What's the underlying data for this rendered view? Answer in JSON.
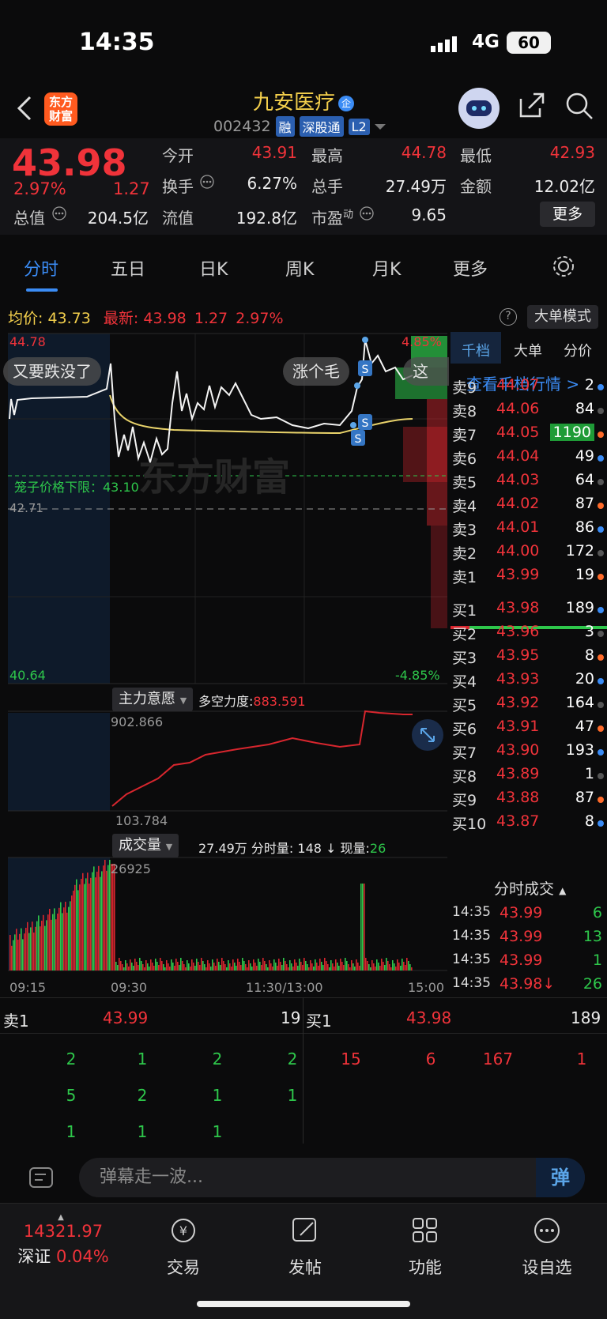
{
  "status_bar": {
    "time": "14:35",
    "network": "4G",
    "battery": "60"
  },
  "header": {
    "back_icon": "chevron-left-icon",
    "logo_text_1": "东方",
    "logo_text_2": "财富",
    "stock_name": "九安医疗",
    "badge": "企",
    "code": "002432",
    "tags": [
      "融",
      "深股通",
      "L2"
    ]
  },
  "quote": {
    "price": "43.98",
    "pct": "2.97%",
    "change": "1.27",
    "fields": [
      {
        "label": "今开",
        "value": "43.91",
        "color": "red"
      },
      {
        "label": "最高",
        "value": "44.78",
        "color": "red"
      },
      {
        "label": "最低",
        "value": "42.93",
        "color": "red"
      },
      {
        "label": "换手",
        "value": "6.27%",
        "color": "white"
      },
      {
        "label": "总手",
        "value": "27.49万",
        "color": "white"
      },
      {
        "label": "金额",
        "value": "12.02亿",
        "color": "white"
      },
      {
        "label": "总值",
        "value": "204.5亿",
        "color": "white"
      },
      {
        "label": "流值",
        "value": "192.8亿",
        "color": "white"
      },
      {
        "label": "市盈",
        "value": "9.65",
        "color": "white",
        "sup": "动"
      }
    ],
    "more_label": "更多"
  },
  "tabs": [
    "分时",
    "五日",
    "日K",
    "周K",
    "月K",
    "更多"
  ],
  "avg_row": {
    "avg_label": "均价:",
    "avg_value": "43.73",
    "latest_label": "最新:",
    "latest_value": "43.98",
    "latest_change": "1.27",
    "latest_pct": "2.97%",
    "bigorder_label": "大单模式"
  },
  "chart": {
    "top_price": "44.78",
    "bottom_price": "40.64",
    "top_pct": "4.85%",
    "bottom_pct": "-4.85%",
    "prev_close": "42.71",
    "cage_label": "笼子价格下限：43.10",
    "bubbles": [
      "又要跌没了",
      "涨个毛",
      "这多"
    ],
    "watermark": "东方财富",
    "ind1_name": "主力意愿",
    "ind1_label": "多空力度:",
    "ind1_value": "883.591",
    "ind1_max": "902.866",
    "ind1_min": "103.784",
    "ind2_name": "成交量",
    "ind2_total": "27.49万",
    "ind2_min_label": "分时量: 148 ↓",
    "ind2_now_label": "现量:",
    "ind2_now_value": "26",
    "ind2_max": "26925",
    "time_labels": [
      "09:15",
      "09:30",
      "11:30/13:00",
      "15:00"
    ]
  },
  "book": {
    "tabs": [
      "千档",
      "大单",
      "分价"
    ],
    "link": "查看千档行情 >",
    "asks": [
      {
        "label": "卖9",
        "price": "44.07",
        "vol": "2"
      },
      {
        "label": "卖8",
        "price": "44.06",
        "vol": "84"
      },
      {
        "label": "卖7",
        "price": "44.05",
        "vol": "1190"
      },
      {
        "label": "卖6",
        "price": "44.04",
        "vol": "49"
      },
      {
        "label": "卖5",
        "price": "44.03",
        "vol": "64"
      },
      {
        "label": "卖4",
        "price": "44.02",
        "vol": "87"
      },
      {
        "label": "卖3",
        "price": "44.01",
        "vol": "86"
      },
      {
        "label": "卖2",
        "price": "44.00",
        "vol": "172"
      },
      {
        "label": "卖1",
        "price": "43.99",
        "vol": "19"
      }
    ],
    "bids": [
      {
        "label": "买1",
        "price": "43.98",
        "vol": "189"
      },
      {
        "label": "买2",
        "price": "43.96",
        "vol": "3"
      },
      {
        "label": "买3",
        "price": "43.95",
        "vol": "8"
      },
      {
        "label": "买4",
        "price": "43.93",
        "vol": "20"
      },
      {
        "label": "买5",
        "price": "43.92",
        "vol": "164"
      },
      {
        "label": "买6",
        "price": "43.91",
        "vol": "47"
      },
      {
        "label": "买7",
        "price": "43.90",
        "vol": "193"
      },
      {
        "label": "买8",
        "price": "43.89",
        "vol": "1"
      },
      {
        "label": "买9",
        "price": "43.88",
        "vol": "87"
      },
      {
        "label": "买10",
        "price": "43.87",
        "vol": "8"
      }
    ],
    "ticks_title": "分时成交",
    "ticks": [
      {
        "time": "14:35",
        "price": "43.99",
        "vol": "6"
      },
      {
        "time": "14:35",
        "price": "43.99",
        "vol": "13"
      },
      {
        "time": "14:35",
        "price": "43.99",
        "vol": "1"
      },
      {
        "time": "14:35",
        "price": "43.98↓",
        "vol": "26"
      }
    ]
  },
  "l2": {
    "sell_label": "卖1",
    "sell_price": "43.99",
    "sell_vol": "19",
    "buy_label": "买1",
    "buy_price": "43.98",
    "buy_vol": "189",
    "sell_queue": [
      "2",
      "1",
      "2",
      "2",
      "5",
      "2",
      "1",
      "1",
      "1",
      "1",
      "1"
    ],
    "buy_queue": [
      "15",
      "6",
      "167",
      "1"
    ]
  },
  "comment": {
    "placeholder": "弹幕走一波...",
    "danmu_label": "弹"
  },
  "bottom_nav": {
    "index_value": "14321.97",
    "index_name": "深证",
    "index_pct": "0.04%",
    "items": [
      "交易",
      "发帖",
      "功能",
      "设自选"
    ]
  }
}
